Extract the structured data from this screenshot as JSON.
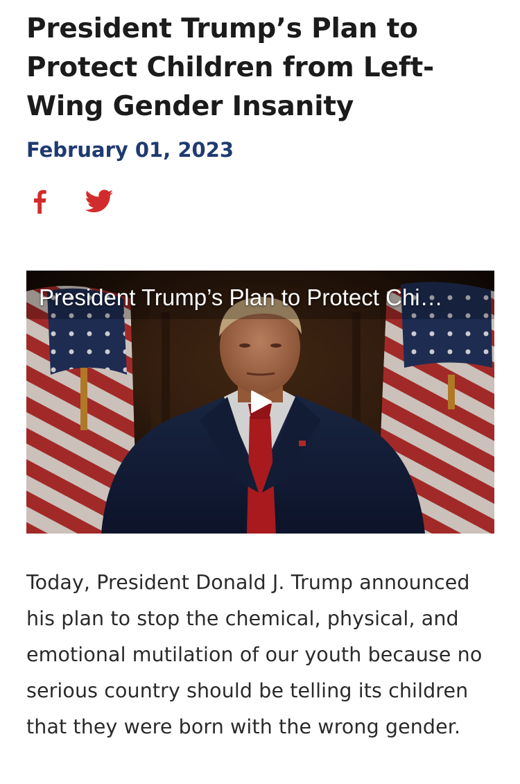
{
  "article": {
    "headline": "President Trump’s Plan to Protect Children from Left-Wing Gender Insanity",
    "date": "February 01, 2023",
    "share": {
      "icons": [
        "facebook-icon",
        "twitter-icon"
      ],
      "color": "#d12c2c"
    },
    "video": {
      "title": "President Trump’s Plan to Protect Chi…",
      "play_icon": "play-icon"
    },
    "body": "Today, President Donald J. Trump announced his plan to stop the chemical, physical, and emotional mutilation of our youth because no serious country should be telling its children that they were born with the wrong gender."
  },
  "colors": {
    "headline": "#1b1b1b",
    "date": "#1f3a70",
    "body": "#2a2a2a",
    "accent": "#d12c2c"
  }
}
